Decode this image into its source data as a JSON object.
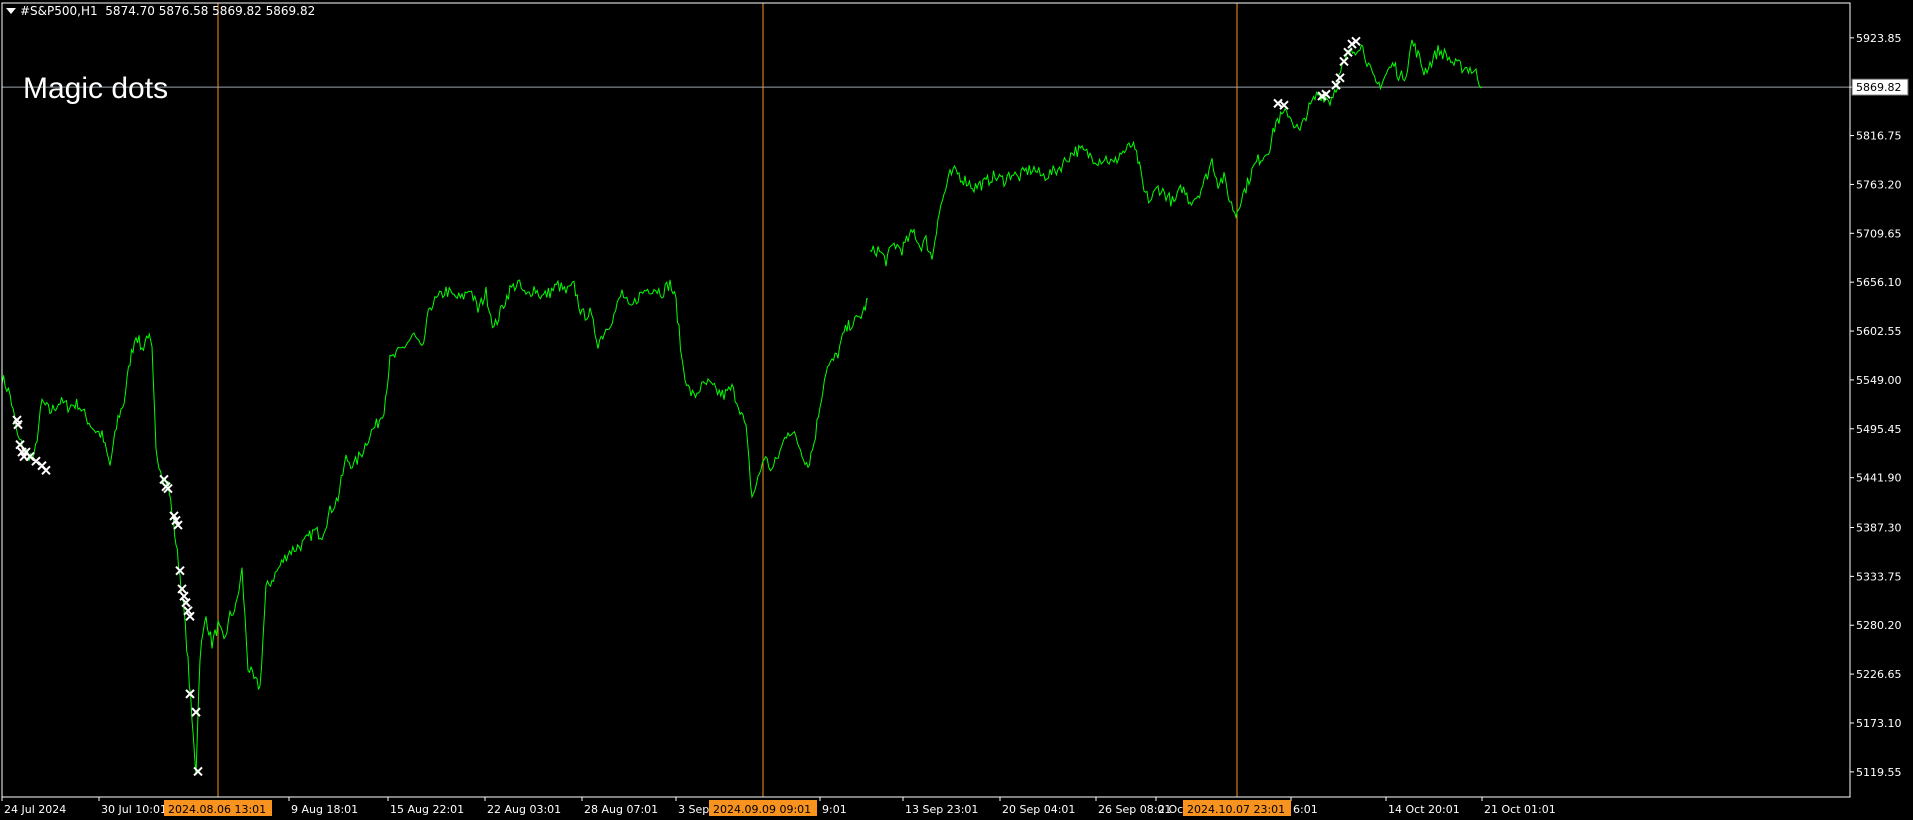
{
  "header": {
    "symbol_timeframe": "#S&P500,H1",
    "ohlc": "5874.70 5876.58 5869.82 5869.82"
  },
  "annotation": "Magic dots",
  "colors": {
    "background": "#000000",
    "price_line": "#00ff00",
    "markers": "#ffffff",
    "separators": "#f7931e",
    "current_price_line": "#9aa3a8",
    "axis": "#ffffff",
    "date_highlight": "#f7931e"
  },
  "chart_data": {
    "type": "line",
    "series_name": "",
    "current_price": "5869.82",
    "ylim": [
      5092.0,
      5962.0
    ],
    "y_ticks": [
      "5923.85",
      "5869.82",
      "5816.75",
      "5763.20",
      "5709.65",
      "5656.10",
      "5602.55",
      "5549.00",
      "5495.45",
      "5441.90",
      "5387.30",
      "5333.75",
      "5280.20",
      "5226.65",
      "5173.10",
      "5119.55"
    ],
    "x_ticks": [
      "24 Jul 2024",
      "30 Jul 10:01",
      "9 Aug 18:01",
      "15 Aug 22:01",
      "22 Aug 03:01",
      "28 Aug 07:01",
      "3 Sep",
      "9:01",
      "13 Sep 23:01",
      "20 Sep 04:01",
      "26 Sep 08:01",
      "2 Oc",
      "6:01",
      "14 Oct 20:01",
      "21 Oct 01:01"
    ],
    "x_range": [
      0,
      1480
    ],
    "x_tick_positions": [
      0,
      97,
      287,
      386,
      483,
      580,
      674,
      818,
      901,
      998,
      1094,
      1154,
      1289,
      1384,
      1480
    ],
    "highlighted_dates": [
      {
        "label": "2024.08.06 13:01",
        "x": 216
      },
      {
        "label": "2024.09.09 09:01",
        "x": 761
      },
      {
        "label": "2024.10.07 23:01",
        "x": 1235
      }
    ],
    "price_path": [
      [
        0,
        5552
      ],
      [
        8,
        5533
      ],
      [
        16,
        5485
      ],
      [
        24,
        5470
      ],
      [
        32,
        5462
      ],
      [
        40,
        5525
      ],
      [
        48,
        5514
      ],
      [
        58,
        5525
      ],
      [
        66,
        5520
      ],
      [
        76,
        5523
      ],
      [
        84,
        5508
      ],
      [
        92,
        5495
      ],
      [
        100,
        5488
      ],
      [
        108,
        5455
      ],
      [
        116,
        5507
      ],
      [
        122,
        5525
      ],
      [
        128,
        5570
      ],
      [
        134,
        5600
      ],
      [
        140,
        5582
      ],
      [
        146,
        5600
      ],
      [
        150,
        5580
      ],
      [
        154,
        5470
      ],
      [
        160,
        5447
      ],
      [
        166,
        5435
      ],
      [
        170,
        5405
      ],
      [
        174,
        5370
      ],
      [
        178,
        5335
      ],
      [
        182,
        5295
      ],
      [
        186,
        5240
      ],
      [
        190,
        5175
      ],
      [
        194,
        5120
      ],
      [
        198,
        5248
      ],
      [
        204,
        5290
      ],
      [
        210,
        5260
      ],
      [
        216,
        5280
      ],
      [
        222,
        5262
      ],
      [
        228,
        5290
      ],
      [
        234,
        5300
      ],
      [
        240,
        5340
      ],
      [
        246,
        5235
      ],
      [
        252,
        5220
      ],
      [
        258,
        5212
      ],
      [
        264,
        5320
      ],
      [
        270,
        5330
      ],
      [
        278,
        5345
      ],
      [
        286,
        5360
      ],
      [
        294,
        5365
      ],
      [
        302,
        5370
      ],
      [
        312,
        5383
      ],
      [
        320,
        5380
      ],
      [
        328,
        5405
      ],
      [
        336,
        5420
      ],
      [
        344,
        5463
      ],
      [
        352,
        5455
      ],
      [
        360,
        5470
      ],
      [
        368,
        5490
      ],
      [
        376,
        5502
      ],
      [
        382,
        5518
      ],
      [
        388,
        5570
      ],
      [
        396,
        5578
      ],
      [
        404,
        5588
      ],
      [
        412,
        5598
      ],
      [
        420,
        5580
      ],
      [
        428,
        5630
      ],
      [
        436,
        5638
      ],
      [
        444,
        5647
      ],
      [
        452,
        5640
      ],
      [
        460,
        5638
      ],
      [
        468,
        5650
      ],
      [
        476,
        5625
      ],
      [
        484,
        5645
      ],
      [
        492,
        5605
      ],
      [
        500,
        5628
      ],
      [
        508,
        5648
      ],
      [
        516,
        5655
      ],
      [
        524,
        5640
      ],
      [
        532,
        5650
      ],
      [
        540,
        5640
      ],
      [
        548,
        5645
      ],
      [
        556,
        5653
      ],
      [
        564,
        5645
      ],
      [
        572,
        5652
      ],
      [
        580,
        5620
      ],
      [
        588,
        5622
      ],
      [
        596,
        5590
      ],
      [
        604,
        5605
      ],
      [
        612,
        5620
      ],
      [
        620,
        5645
      ],
      [
        628,
        5625
      ],
      [
        636,
        5640
      ],
      [
        644,
        5648
      ],
      [
        652,
        5650
      ],
      [
        660,
        5645
      ],
      [
        668,
        5655
      ],
      [
        674,
        5635
      ],
      [
        680,
        5570
      ],
      [
        686,
        5540
      ],
      [
        692,
        5530
      ],
      [
        698,
        5540
      ],
      [
        706,
        5545
      ],
      [
        714,
        5537
      ],
      [
        722,
        5532
      ],
      [
        730,
        5540
      ],
      [
        738,
        5518
      ],
      [
        744,
        5495
      ],
      [
        750,
        5420
      ],
      [
        756,
        5440
      ],
      [
        762,
        5465
      ],
      [
        770,
        5450
      ],
      [
        778,
        5470
      ],
      [
        786,
        5495
      ],
      [
        794,
        5485
      ],
      [
        800,
        5470
      ],
      [
        806,
        5455
      ],
      [
        812,
        5480
      ],
      [
        818,
        5522
      ],
      [
        824,
        5560
      ],
      [
        830,
        5568
      ],
      [
        836,
        5578
      ],
      [
        842,
        5600
      ],
      [
        848,
        5610
      ],
      [
        856,
        5615
      ],
      [
        862,
        5625
      ],
      [
        866,
        5638
      ],
      null,
      [
        868,
        5688
      ],
      [
        876,
        5692
      ],
      [
        884,
        5680
      ],
      [
        892,
        5698
      ],
      [
        900,
        5692
      ],
      [
        906,
        5703
      ],
      [
        912,
        5712
      ],
      [
        918,
        5695
      ],
      [
        924,
        5702
      ],
      [
        930,
        5682
      ],
      [
        936,
        5727
      ],
      [
        942,
        5752
      ],
      [
        948,
        5773
      ],
      [
        954,
        5778
      ],
      [
        960,
        5770
      ],
      [
        966,
        5766
      ],
      [
        972,
        5760
      ],
      [
        978,
        5763
      ],
      [
        984,
        5765
      ],
      [
        990,
        5772
      ],
      [
        996,
        5770
      ],
      [
        1002,
        5768
      ],
      [
        1010,
        5776
      ],
      [
        1016,
        5770
      ],
      [
        1024,
        5778
      ],
      [
        1032,
        5780
      ],
      [
        1040,
        5772
      ],
      [
        1048,
        5775
      ],
      [
        1056,
        5780
      ],
      [
        1064,
        5790
      ],
      [
        1072,
        5800
      ],
      [
        1080,
        5800
      ],
      [
        1088,
        5795
      ],
      [
        1096,
        5790
      ],
      [
        1104,
        5792
      ],
      [
        1112,
        5785
      ],
      [
        1118,
        5797
      ],
      [
        1124,
        5800
      ],
      [
        1130,
        5807
      ],
      [
        1136,
        5790
      ],
      [
        1142,
        5755
      ],
      [
        1148,
        5745
      ],
      [
        1156,
        5760
      ],
      [
        1164,
        5752
      ],
      [
        1172,
        5742
      ],
      [
        1180,
        5760
      ],
      [
        1188,
        5745
      ],
      [
        1196,
        5752
      ],
      [
        1204,
        5770
      ],
      [
        1210,
        5790
      ],
      [
        1216,
        5765
      ],
      [
        1222,
        5770
      ],
      [
        1228,
        5745
      ],
      [
        1234,
        5730
      ],
      [
        1238,
        5745
      ],
      [
        1244,
        5760
      ],
      [
        1250,
        5778
      ],
      [
        1256,
        5790
      ],
      [
        1262,
        5795
      ],
      [
        1268,
        5805
      ],
      [
        1274,
        5832
      ],
      [
        1280,
        5838
      ],
      [
        1286,
        5842
      ],
      [
        1292,
        5830
      ],
      [
        1298,
        5820
      ],
      [
        1304,
        5840
      ],
      [
        1310,
        5852
      ],
      [
        1316,
        5863
      ],
      [
        1322,
        5860
      ],
      [
        1328,
        5855
      ],
      [
        1334,
        5870
      ],
      [
        1340,
        5890
      ],
      [
        1346,
        5905
      ],
      [
        1352,
        5910
      ],
      [
        1358,
        5917
      ],
      [
        1362,
        5910
      ],
      [
        1368,
        5888
      ],
      [
        1374,
        5872
      ],
      [
        1380,
        5875
      ],
      [
        1386,
        5888
      ],
      [
        1392,
        5895
      ],
      [
        1398,
        5880
      ],
      [
        1404,
        5885
      ],
      [
        1410,
        5920
      ],
      [
        1416,
        5905
      ],
      [
        1422,
        5887
      ],
      [
        1428,
        5895
      ],
      [
        1436,
        5910
      ],
      [
        1444,
        5905
      ],
      [
        1452,
        5895
      ],
      [
        1460,
        5892
      ],
      [
        1468,
        5890
      ],
      [
        1474,
        5885
      ],
      [
        1480,
        5870
      ]
    ],
    "markers": [
      [
        15,
        5505
      ],
      [
        16,
        5500
      ],
      [
        18,
        5478
      ],
      [
        20,
        5470
      ],
      [
        22,
        5465
      ],
      [
        24,
        5470
      ],
      [
        28,
        5465
      ],
      [
        34,
        5460
      ],
      [
        40,
        5455
      ],
      [
        44,
        5450
      ],
      [
        162,
        5440
      ],
      [
        164,
        5432
      ],
      [
        166,
        5430
      ],
      [
        172,
        5400
      ],
      [
        174,
        5395
      ],
      [
        176,
        5390
      ],
      [
        178,
        5340
      ],
      [
        180,
        5320
      ],
      [
        182,
        5312
      ],
      [
        184,
        5305
      ],
      [
        186,
        5296
      ],
      [
        188,
        5290
      ],
      [
        188,
        5205
      ],
      [
        194,
        5185
      ],
      [
        196,
        5120
      ],
      [
        1276,
        5852
      ],
      [
        1282,
        5850
      ],
      [
        1320,
        5860
      ],
      [
        1324,
        5862
      ],
      [
        1334,
        5872
      ],
      [
        1338,
        5880
      ],
      [
        1342,
        5898
      ],
      [
        1346,
        5908
      ],
      [
        1350,
        5917
      ],
      [
        1354,
        5920
      ]
    ]
  }
}
